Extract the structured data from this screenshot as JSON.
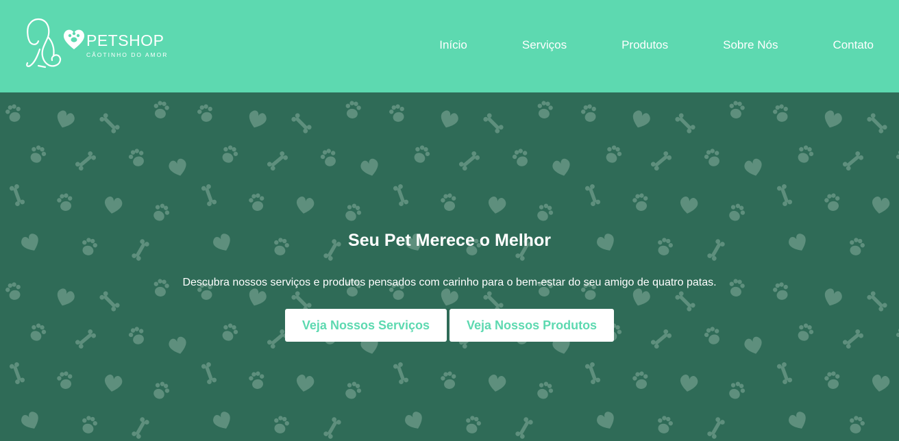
{
  "brand": {
    "name": "PETSHOP",
    "tagline": "CÃOTINHO DO AMOR",
    "logo_icon": "dog-heart-paw-logo"
  },
  "nav": {
    "items": [
      {
        "label": "Início"
      },
      {
        "label": "Serviços"
      },
      {
        "label": "Produtos"
      },
      {
        "label": "Sobre Nós"
      },
      {
        "label": "Contato"
      }
    ]
  },
  "hero": {
    "title": "Seu Pet Merece o Melhor",
    "subtitle": "Descubra nossos serviços e produtos pensados com carinho para o bem-estar do seu amigo de quatro patas.",
    "buttons": {
      "services_label": "Veja Nossos Serviços",
      "products_label": "Veja Nossos Produtos"
    },
    "pattern_icons": [
      "paw-icon",
      "heart-icon",
      "bone-icon"
    ]
  },
  "colors": {
    "header_bg": "#5dd9b0",
    "hero_bg": "#2f6b57",
    "pattern": "#5e8f7d",
    "button_bg": "#ffffff",
    "button_text": "#5dd9b0"
  }
}
